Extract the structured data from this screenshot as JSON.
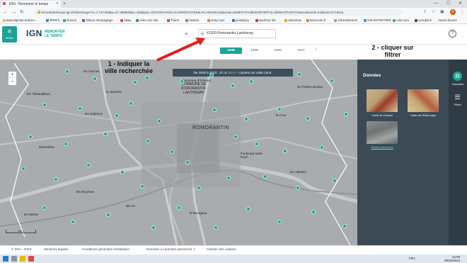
{
  "browser": {
    "tab_title": "IGN : Remonter le temps",
    "tab_close": "✕",
    "new_tab": "+",
    "url": "remonterletemps.ign.fr/telecharger?x=1.747259&y=47.358806&z=15&layer=GEOGRAPHICALGRIDSYSTEMS.PLANIGNV2&demat=DEMAT.PVA$GEOPORTAIL:DEMAT;PHOTOS&missionId=missions.5718411",
    "window_controls": [
      "—",
      "☐",
      "✕"
    ],
    "avatar_letter": "R"
  },
  "bookmarks": [
    {
      "label": "www.laposte.net/acc...",
      "color": "#f1c40f"
    },
    {
      "label": "BPEFC",
      "color": "#2e86de"
    },
    {
      "label": "Bourse",
      "color": "#27ae60"
    },
    {
      "label": "Yahoo! Interpagings",
      "color": "#8e44ad"
    },
    {
      "label": "eBay",
      "color": "#e74c3c"
    },
    {
      "label": "créer son site",
      "color": "#16a085"
    },
    {
      "label": "Trains",
      "color": "#d35400"
    },
    {
      "label": "histoire",
      "color": "#7f8c8d"
    },
    {
      "label": "oinky toys",
      "color": "#e67e22"
    },
    {
      "label": "joomlgrey",
      "color": "#2980b9"
    },
    {
      "label": "imprimer lire",
      "color": "#c0392b"
    },
    {
      "label": "delcampe",
      "color": "#f39c12"
    },
    {
      "label": "leboncoin.fr",
      "color": "#e67e22"
    },
    {
      "label": "Advertisement",
      "color": "#95a5a6"
    },
    {
      "label": "108 ENTRETIEN",
      "color": "#3498db"
    },
    {
      "label": "cast.com",
      "color": "#1abc9c"
    },
    {
      "label": "ca-toplink",
      "color": "#34495e"
    }
  ],
  "bookmarks_other": "Autres favoris",
  "header": {
    "menu_label": "MENU",
    "logo": "IGN",
    "tagline_1": "REMONTER",
    "tagline_2": "LE TEMPS",
    "search_value": "41200 Romorantin-Lanthenay",
    "help": "?"
  },
  "years": [
    {
      "label": "1949",
      "active": true
    },
    {
      "label": "1946",
      "active": false
    },
    {
      "label": "1948",
      "active": false
    },
    {
      "label": "1947",
      "active": false
    }
  ],
  "year_next": "›",
  "map": {
    "zoom_in": "+",
    "zoom_out": "−",
    "banner": "De 1919 à 2023 : 37 missions trouvées sur cette zone.",
    "commune_label_1": "COMMUNE DE",
    "commune_label_2": "ROMORANTIN-",
    "commune_label_3": "LANTHENAY",
    "city_label": "ROMORANTIN",
    "place_labels": [
      "les Thibaudières",
      "les Ouches",
      "la Jaunière",
      "les Petites Bordes",
      "Faubourg Saint Roch",
      "les Bruyères",
      "le Bourgeau",
      "Bel Air",
      "les Barres",
      "la Grange",
      "Faubourg d'Orléans",
      "les Rabières",
      "la Cour",
      "les Valettes",
      "Bénardière"
    ],
    "scale_label": "500 m"
  },
  "annotations": {
    "left_1": "1 - Indiquer la",
    "left_2": "ville recherchée",
    "right_1": "2 - cliquer sur",
    "right_2": "filtrer"
  },
  "panel": {
    "title": "Données",
    "items": [
      {
        "label": "Carte de Cassini"
      },
      {
        "label": "Carte de l'État-major"
      },
      {
        "label": "Photos aériennes"
      }
    ]
  },
  "rail": {
    "data_label": "Données",
    "filter_label": "Filtrer"
  },
  "footer": {
    "copyright": "© IGN – 2023",
    "links": [
      "Mentions légales",
      "Conditions générales d'utilisation",
      "Données à caractère personnel ↗",
      "Gestion des cookies"
    ]
  },
  "taskbar": {
    "lang": "FRA",
    "time": "22:09",
    "date": "30/10/2023"
  }
}
